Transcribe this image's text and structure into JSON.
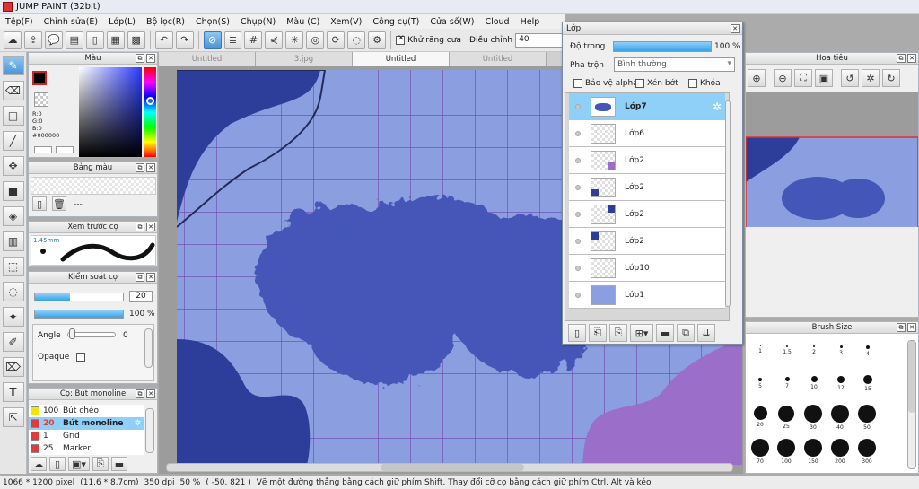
{
  "window": {
    "title": "JUMP PAINT (32bit)"
  },
  "menu": [
    "Tệp(F)",
    "Chỉnh sửa(E)",
    "Lớp(L)",
    "Bộ lọc(R)",
    "Chọn(S)",
    "Chụp(N)",
    "Màu (C)",
    "Xem(V)",
    "Công cụ(T)",
    "Cửa số(W)",
    "Cloud",
    "Help"
  ],
  "toolbar": {
    "antialias_label": "Khử răng cưa",
    "adjust_label": "Điều chỉnh",
    "adjust_value": "40"
  },
  "canvas_tabs": [
    {
      "label": "Untitled",
      "active": false
    },
    {
      "label": "3.jpg",
      "active": false
    },
    {
      "label": "Untitled",
      "active": true
    },
    {
      "label": "Untitled",
      "active": false
    }
  ],
  "color_panel": {
    "title": "Màu",
    "r": "R:0",
    "g": "G:0",
    "b": "B:0",
    "hex": "#000000",
    "fg_color": "#000000"
  },
  "swatch_panel": {
    "title": "Bảng màu",
    "value": "---"
  },
  "brush_preview_panel": {
    "title": "Xem trước cọ",
    "size": "1.45mm"
  },
  "brush_control_panel": {
    "title": "Kiểm soát cọ",
    "size_value": "20",
    "opacity_value": "100 %",
    "angle_label": "Angle",
    "angle_value": "0",
    "opaque_label": "Opaque",
    "size_fill": 0.4,
    "opacity_fill": 1.0
  },
  "brush_list_panel": {
    "title": "Cọ: Bút monoline",
    "items": [
      {
        "size": "100",
        "name": "Bút chéo",
        "color": "#f2e600",
        "selected": false
      },
      {
        "size": "20",
        "name": "Bút monoline",
        "color": "#e23b3b",
        "selected": true
      },
      {
        "size": "1",
        "name": "Grid",
        "color": "#e23b3b",
        "selected": false
      },
      {
        "size": "25",
        "name": "Marker",
        "color": "#e23b3b",
        "selected": false
      }
    ]
  },
  "layer_panel": {
    "title": "Lớp",
    "opacity_label": "Độ trong",
    "opacity_value": "100 %",
    "opacity_fill": 1.0,
    "blend_label": "Pha trộn",
    "blend_value": "Bình thường",
    "protect_alpha_label": "Bảo vệ alpha",
    "clip_label": "Xén bớt",
    "lock_label": "Khóa",
    "layers": [
      {
        "name": "Lớp7",
        "selected": true
      },
      {
        "name": "Lớp6",
        "selected": false
      },
      {
        "name": "Lớp2",
        "selected": false
      },
      {
        "name": "Lớp2",
        "selected": false
      },
      {
        "name": "Lớp2",
        "selected": false
      },
      {
        "name": "Lớp2",
        "selected": false
      },
      {
        "name": "Lớp10",
        "selected": false
      },
      {
        "name": "Lớp1",
        "selected": false
      }
    ]
  },
  "navigator_panel": {
    "title": "Hoa tiêu"
  },
  "brush_size_panel": {
    "title": "Brush Size",
    "sizes": [
      "1",
      "1.5",
      "2",
      "3",
      "4",
      "5",
      "7",
      "10",
      "12",
      "15",
      "20",
      "25",
      "30",
      "40",
      "50",
      "70",
      "100",
      "150",
      "200",
      "300"
    ]
  },
  "status": {
    "pixels": "1066 * 1200 pixel",
    "physical": "(11.6 * 8.7cm)",
    "dpi": "350 dpi",
    "zoom": "50 %",
    "coords": "( -50, 821 )",
    "hint": "Vẽ một đường thẳng bằng cách giữ phím Shift, Thay đổi cỡ cọ bằng cách giữ phím Ctrl, Alt và kéo"
  },
  "colors": {
    "canvas_bg": "#8a9ee0",
    "blob": "#4457b8",
    "dark_blue": "#2c3d9a",
    "purple": "#9b6fc9",
    "grid": "#6b2fa0",
    "accent": "#4b93d6"
  }
}
